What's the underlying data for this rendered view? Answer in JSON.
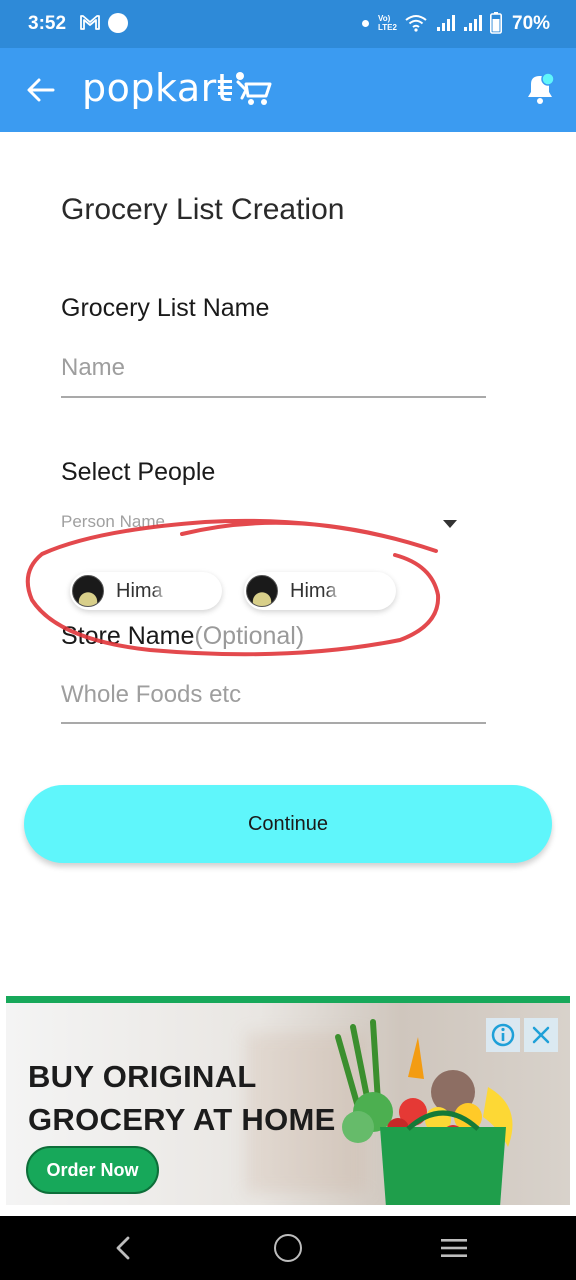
{
  "status_bar": {
    "time": "3:52",
    "volte_line1": "Vo)",
    "volte_line2": "LTE2",
    "battery": "70%"
  },
  "app_bar": {
    "logo": "popkart",
    "brand_color": "#3b9bf1"
  },
  "form": {
    "title": "Grocery List Creation",
    "list_name_label": "Grocery List Name",
    "list_name_placeholder": "Name",
    "people_label": "Select People",
    "person_placeholder": "Person Name",
    "selected_people": [
      {
        "name": "Hima"
      },
      {
        "name": "Hima"
      }
    ],
    "store_label": "Store Name",
    "store_optional": "(Optional)",
    "store_placeholder": "Whole Foods etc",
    "continue_label": "Continue",
    "accent_color": "#5ff6fb"
  },
  "ad": {
    "headline_line1": "BUY ORIGINAL",
    "headline_line2": "GROCERY AT HOME",
    "cta": "Order Now",
    "info_icon": "info-icon",
    "close_icon": "close-icon"
  }
}
